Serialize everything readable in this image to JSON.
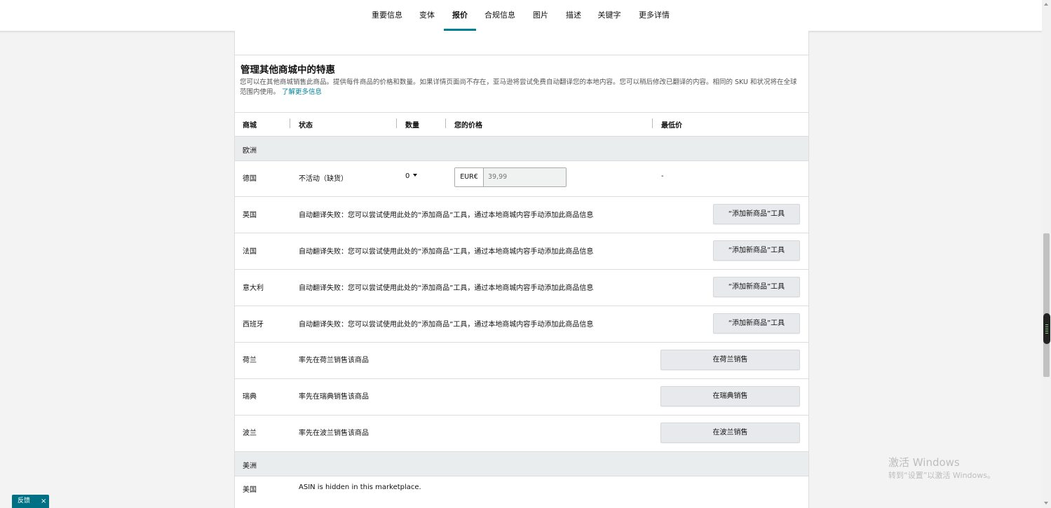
{
  "nav": {
    "tabs": [
      "重要信息",
      "变体",
      "报价",
      "合规信息",
      "图片",
      "描述",
      "关键字",
      "更多详情"
    ],
    "active_tab": "报价"
  },
  "section": {
    "title": "管理其他商城中的特惠",
    "description": "您可以在其他商城销售此商品。提供每件商品的价格和数量。如果详情页面尚不存在，亚马逊将尝试免费自动翻译您的本地内容。您可以稍后修改已翻译的内容。相同的 SKU 和状况将在全球范围内使用。",
    "learn_more": "了解更多信息"
  },
  "table": {
    "headers": [
      "商城",
      "状态",
      "数量",
      "您的价格",
      "最低价"
    ],
    "groups": [
      "欧洲",
      "美洲"
    ],
    "rows": [
      {
        "market": "德国",
        "status": "不活动（缺货）",
        "quantity": "0",
        "currency": "EUR€",
        "price_placeholder": "39,99",
        "lowest": "-"
      },
      {
        "market": "英国",
        "status": "自动翻译失败：您可以尝试使用此处的“添加商品”工具，通过本地商城内容手动添加此商品信息",
        "button": "“添加新商品”工具"
      },
      {
        "market": "法国",
        "status": "自动翻译失败：您可以尝试使用此处的“添加商品”工具，通过本地商城内容手动添加此商品信息",
        "button": "“添加新商品”工具"
      },
      {
        "market": "意大利",
        "status": "自动翻译失败：您可以尝试使用此处的“添加商品”工具，通过本地商城内容手动添加此商品信息",
        "button": "“添加新商品”工具"
      },
      {
        "market": "西班牙",
        "status": "自动翻译失败：您可以尝试使用此处的“添加商品”工具，通过本地商城内容手动添加此商品信息",
        "button": "“添加新商品”工具"
      },
      {
        "market": "荷兰",
        "status": "率先在荷兰销售该商品",
        "button": "在荷兰销售"
      },
      {
        "market": "瑞典",
        "status": "率先在瑞典销售该商品",
        "button": "在瑞典销售"
      },
      {
        "market": "波兰",
        "status": "率先在波兰销售该商品",
        "button": "在波兰销售"
      },
      {
        "market": "美国",
        "status": "ASIN is hidden in this marketplace."
      }
    ]
  },
  "watermark": {
    "line1": "激活 Windows",
    "line2": "转到“设置”以激活 Windows。"
  },
  "feedback": {
    "label": "反馈",
    "close": "×"
  },
  "colors": {
    "accent": "#008296",
    "button_bg": "#e7e9ec",
    "group_bg": "#eaeded",
    "feedback_bg": "#007185"
  }
}
